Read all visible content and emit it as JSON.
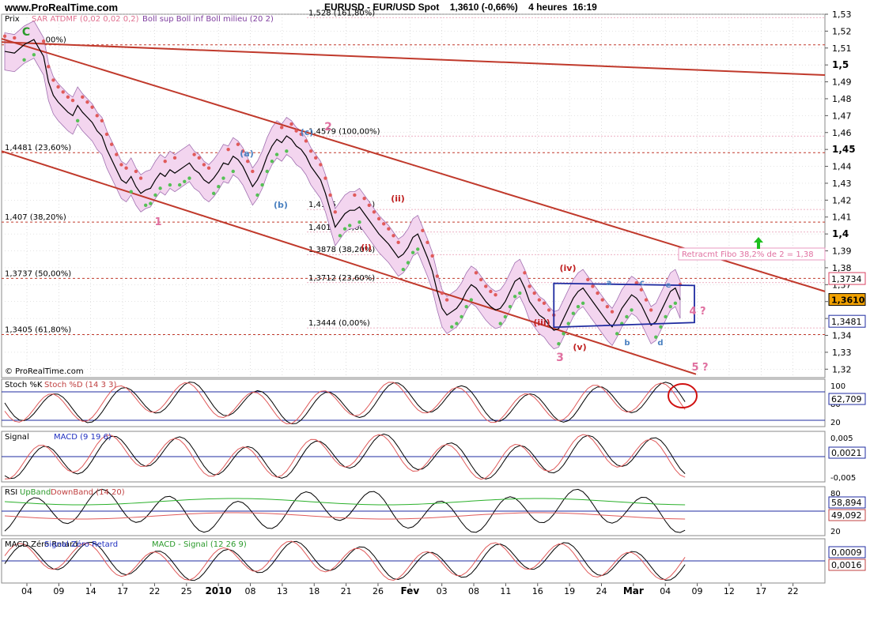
{
  "header": {
    "site": "www.ProRealTime.com",
    "symbol": "EURUSD - EUR/USD Spot",
    "last": "1,3610 (-0,66%)",
    "period": "4 heures",
    "time": "16:19"
  },
  "colors": {
    "bg": "#ffffff",
    "grid": "#c9c9c9",
    "channel": "#c0392b",
    "sar_red": "#e05a5a",
    "sar_green": "#55c055",
    "boll_fill": "#f3d5ef",
    "boll_line": "#a070b0",
    "price": "#000000",
    "fibo": "#d94060",
    "box": "#1f2ba0",
    "arrow": "#1fbf1f",
    "last_badge": "#f2a200"
  },
  "chart_data": {
    "type": "line",
    "instrument": "EURUSD",
    "price_panel": {
      "label": "Prix",
      "legend": [
        "SAR ATDMF (0,02 0,02 0,2)",
        "Boll sup Boll inf Boll milieu (20 2)"
      ],
      "ylim": [
        1.315,
        1.53
      ],
      "y_ticks": [
        "1,53",
        "1,52",
        "1,51",
        "1,5",
        "1,49",
        "1,48",
        "1,47",
        "1,46",
        "1,45",
        "1,44",
        "1,43",
        "1,42",
        "1,41",
        "1,4",
        "1,39",
        "1,38",
        "1,37",
        "1,36",
        "1,35",
        "1,34",
        "1,33",
        "1,32"
      ],
      "y_tick_values": [
        1.53,
        1.52,
        1.51,
        1.5,
        1.49,
        1.48,
        1.47,
        1.46,
        1.45,
        1.44,
        1.43,
        1.42,
        1.41,
        1.4,
        1.39,
        1.38,
        1.37,
        1.36,
        1.35,
        1.34,
        1.33,
        1.32
      ],
      "price_series": [
        [
          0,
          1.508
        ],
        [
          2,
          1.507
        ],
        [
          4,
          1.512
        ],
        [
          6,
          1.515
        ],
        [
          8,
          1.505
        ],
        [
          9,
          1.49
        ],
        [
          10,
          1.482
        ],
        [
          11,
          1.478
        ],
        [
          12,
          1.475
        ],
        [
          13,
          1.472
        ],
        [
          14,
          1.47
        ],
        [
          15,
          1.476
        ],
        [
          16,
          1.472
        ],
        [
          17,
          1.469
        ],
        [
          18,
          1.466
        ],
        [
          19,
          1.461
        ],
        [
          20,
          1.458
        ],
        [
          21,
          1.45
        ],
        [
          22,
          1.444
        ],
        [
          23,
          1.438
        ],
        [
          24,
          1.432
        ],
        [
          25,
          1.43
        ],
        [
          26,
          1.434
        ],
        [
          27,
          1.428
        ],
        [
          28,
          1.424
        ],
        [
          29,
          1.426
        ],
        [
          30,
          1.427
        ],
        [
          31,
          1.432
        ],
        [
          32,
          1.436
        ],
        [
          33,
          1.434
        ],
        [
          34,
          1.438
        ],
        [
          35,
          1.436
        ],
        [
          36,
          1.438
        ],
        [
          37,
          1.44
        ],
        [
          38,
          1.442
        ],
        [
          39,
          1.438
        ],
        [
          40,
          1.436
        ],
        [
          41,
          1.432
        ],
        [
          42,
          1.43
        ],
        [
          43,
          1.433
        ],
        [
          44,
          1.437
        ],
        [
          45,
          1.442
        ],
        [
          46,
          1.441
        ],
        [
          47,
          1.446
        ],
        [
          48,
          1.444
        ],
        [
          49,
          1.44
        ],
        [
          50,
          1.434
        ],
        [
          51,
          1.428
        ],
        [
          52,
          1.432
        ],
        [
          53,
          1.438
        ],
        [
          54,
          1.446
        ],
        [
          55,
          1.452
        ],
        [
          56,
          1.456
        ],
        [
          57,
          1.454
        ],
        [
          58,
          1.458
        ],
        [
          59,
          1.456
        ],
        [
          60,
          1.452
        ],
        [
          61,
          1.45
        ],
        [
          62,
          1.446
        ],
        [
          63,
          1.44
        ],
        [
          64,
          1.436
        ],
        [
          65,
          1.432
        ],
        [
          66,
          1.424
        ],
        [
          67,
          1.414
        ],
        [
          68,
          1.404
        ],
        [
          69,
          1.408
        ],
        [
          70,
          1.412
        ],
        [
          71,
          1.414
        ],
        [
          72,
          1.414
        ],
        [
          73,
          1.416
        ],
        [
          74,
          1.412
        ],
        [
          75,
          1.408
        ],
        [
          76,
          1.404
        ],
        [
          77,
          1.4
        ],
        [
          78,
          1.397
        ],
        [
          79,
          1.394
        ],
        [
          80,
          1.39
        ],
        [
          81,
          1.386
        ],
        [
          82,
          1.388
        ],
        [
          83,
          1.392
        ],
        [
          84,
          1.398
        ],
        [
          85,
          1.4
        ],
        [
          86,
          1.393
        ],
        [
          87,
          1.386
        ],
        [
          88,
          1.378
        ],
        [
          89,
          1.366
        ],
        [
          90,
          1.356
        ],
        [
          91,
          1.352
        ],
        [
          92,
          1.354
        ],
        [
          93,
          1.356
        ],
        [
          94,
          1.36
        ],
        [
          95,
          1.366
        ],
        [
          96,
          1.37
        ],
        [
          97,
          1.368
        ],
        [
          98,
          1.364
        ],
        [
          99,
          1.36
        ],
        [
          100,
          1.357
        ],
        [
          101,
          1.355
        ],
        [
          102,
          1.356
        ],
        [
          103,
          1.36
        ],
        [
          104,
          1.366
        ],
        [
          105,
          1.372
        ],
        [
          106,
          1.374
        ],
        [
          107,
          1.368
        ],
        [
          108,
          1.36
        ],
        [
          109,
          1.356
        ],
        [
          110,
          1.352
        ],
        [
          111,
          1.35
        ],
        [
          112,
          1.346
        ],
        [
          113,
          1.343
        ],
        [
          114,
          1.344
        ],
        [
          115,
          1.35
        ],
        [
          116,
          1.356
        ],
        [
          117,
          1.362
        ],
        [
          118,
          1.366
        ],
        [
          119,
          1.368
        ],
        [
          120,
          1.364
        ],
        [
          121,
          1.36
        ],
        [
          122,
          1.356
        ],
        [
          123,
          1.352
        ],
        [
          124,
          1.348
        ],
        [
          125,
          1.345
        ],
        [
          126,
          1.35
        ],
        [
          127,
          1.356
        ],
        [
          128,
          1.36
        ],
        [
          129,
          1.364
        ],
        [
          130,
          1.362
        ],
        [
          131,
          1.358
        ],
        [
          132,
          1.352
        ],
        [
          133,
          1.346
        ],
        [
          134,
          1.348
        ],
        [
          135,
          1.354
        ],
        [
          136,
          1.36
        ],
        [
          137,
          1.366
        ],
        [
          138,
          1.368
        ],
        [
          139,
          1.361
        ]
      ],
      "x_tick_labels": [
        "04",
        "09",
        "14",
        "17",
        "22",
        "25",
        "2010",
        "08",
        "13",
        "18",
        "21",
        "26",
        "Fev",
        "03",
        "08",
        "11",
        "16",
        "19",
        "24",
        "Mar",
        "04",
        "09",
        "12",
        "17",
        "22"
      ],
      "fibo_left": [
        {
          "label": "1,5119 (0,00%)",
          "y": 1.5119
        },
        {
          "label": "1,4481 (23,60%)",
          "y": 1.4481
        },
        {
          "label": "1,407 (38,20%)",
          "y": 1.407
        },
        {
          "label": "1,3737 (50,00%)",
          "y": 1.3737
        },
        {
          "label": "1,3405 (61,80%)",
          "y": 1.3405
        }
      ],
      "fibo_right": [
        {
          "label": "1,528 (161,80%)",
          "y": 1.528
        },
        {
          "label": "1,4579 (100,00%)",
          "y": 1.4579
        },
        {
          "label": "1,4145 (61,80%)",
          "y": 1.4145
        },
        {
          "label": "1,4011 (50,00%)",
          "y": 1.4011
        },
        {
          "label": "1,3878 (38,20%)",
          "y": 1.3878
        },
        {
          "label": "1,3712 (23,60%)",
          "y": 1.3712
        },
        {
          "label": "1,3444 (0,00%)",
          "y": 1.3444
        }
      ],
      "wave_labels": [
        "C",
        "1",
        "2",
        "3",
        "4 ?",
        "5 ?",
        "(a)",
        "(b)",
        "(c)",
        "(i)",
        "(ii)",
        "(iii)",
        "(iv)",
        "(v)",
        "a",
        "b",
        "c",
        "d",
        "e"
      ],
      "annotation": "Retracmt Fibo 38,2% de 2 = 1,38",
      "price_badges": [
        "1,3734",
        "1,3610",
        "1,3481"
      ],
      "copyright": "© ProRealTime.com"
    },
    "panels": [
      {
        "label": "Stoch %K",
        "label2": "Stoch %D (14 3 3)",
        "ticks": [
          "100",
          "80",
          "20"
        ],
        "values": [
          "62,709"
        ]
      },
      {
        "label": "Signal",
        "label2": "MACD (9 19 6)",
        "ticks": [
          "0,005",
          "-0,005"
        ],
        "values": [
          "0,0021"
        ]
      },
      {
        "label": "RSI",
        "label_up": "UpBand",
        "label_down": "DownBand (14 20)",
        "ticks": [
          "80",
          "20"
        ],
        "values": [
          "58,894",
          "49,092"
        ]
      },
      {
        "label": "MACD Zéro Retard",
        "label2": "Signal Zéro Retard",
        "label3": "MACD - Signal (12 26 9)",
        "ticks": [],
        "values": [
          "0,0009",
          "0,0016"
        ]
      }
    ]
  }
}
